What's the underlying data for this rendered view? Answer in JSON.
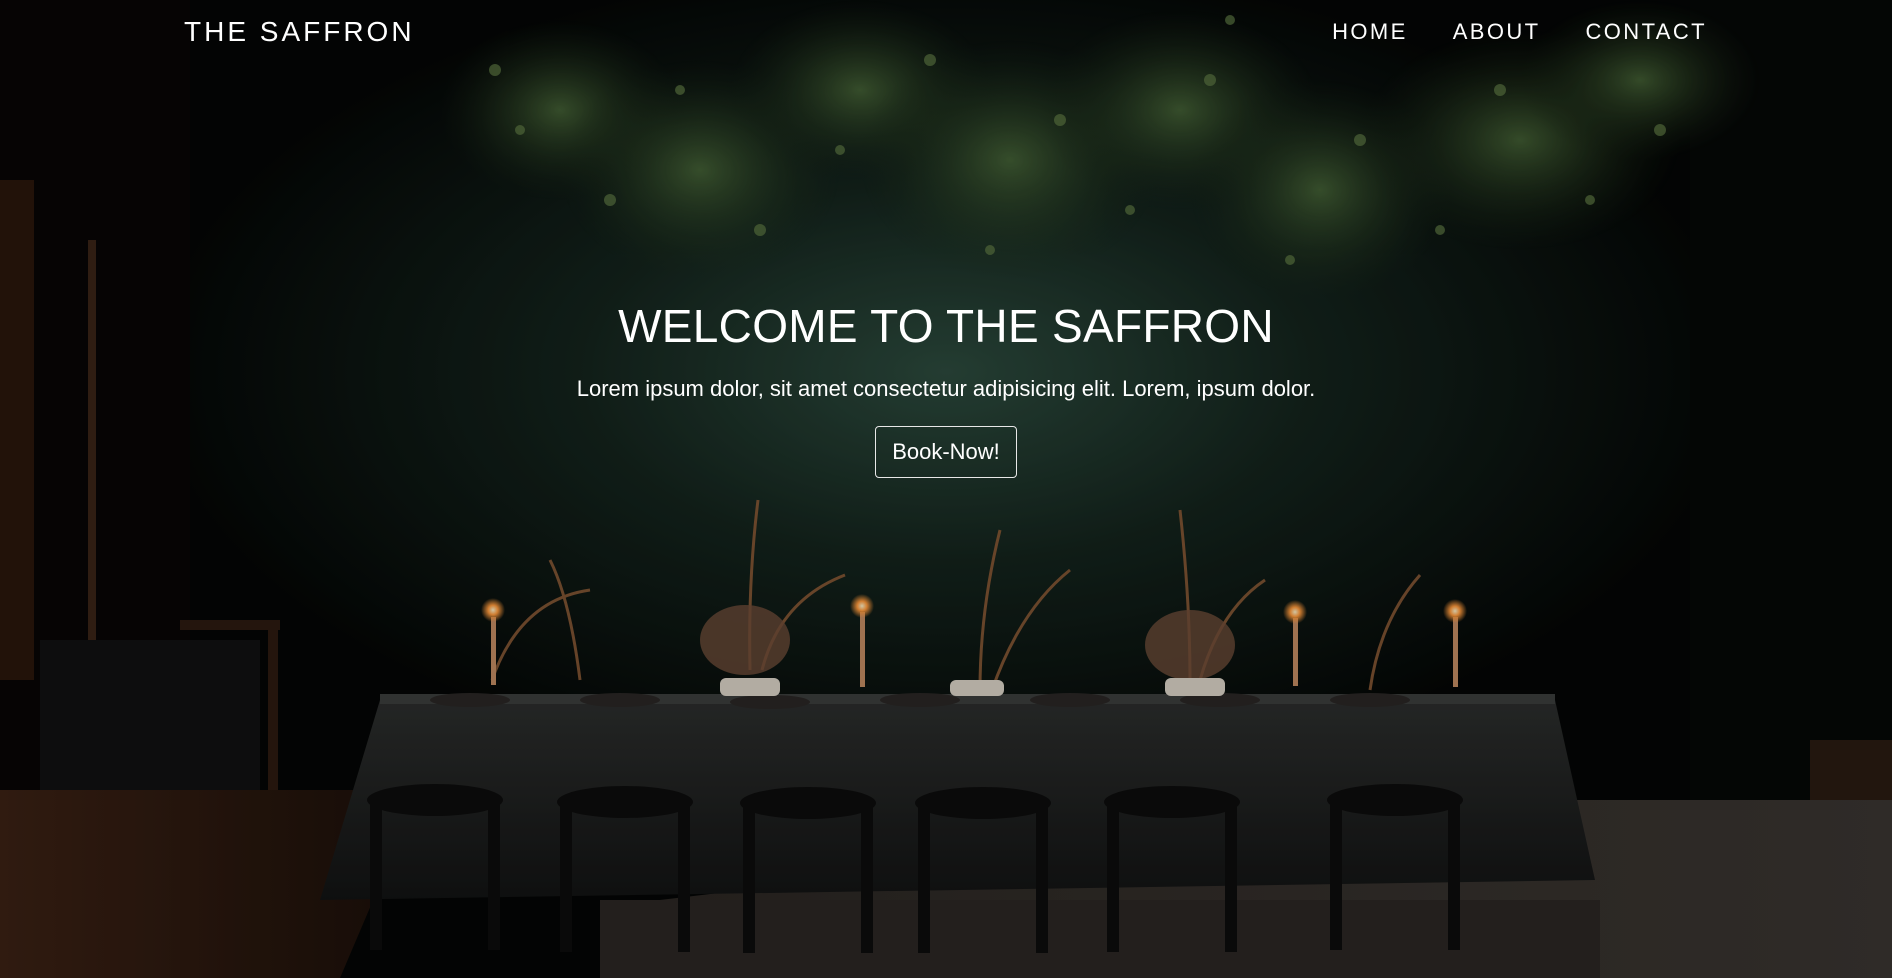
{
  "brand": {
    "name": "THE SAFFRON"
  },
  "nav": {
    "items": [
      {
        "label": "HOME"
      },
      {
        "label": "ABOUT"
      },
      {
        "label": "CONTACT"
      }
    ]
  },
  "hero": {
    "title": "WELCOME TO THE SAFFRON",
    "subtitle": "Lorem ipsum dolor, sit amet consectetur adipisicing elit. Lorem, ipsum dolor.",
    "cta_label": "Book-Now!",
    "background_icon": "restaurant-dining-photo-icon"
  },
  "colors": {
    "text": "#ffffff",
    "background": "#050706",
    "wall_green": "#1f3a30",
    "candle": "#ff9a3c",
    "wood_floor": "#3a1f12"
  }
}
